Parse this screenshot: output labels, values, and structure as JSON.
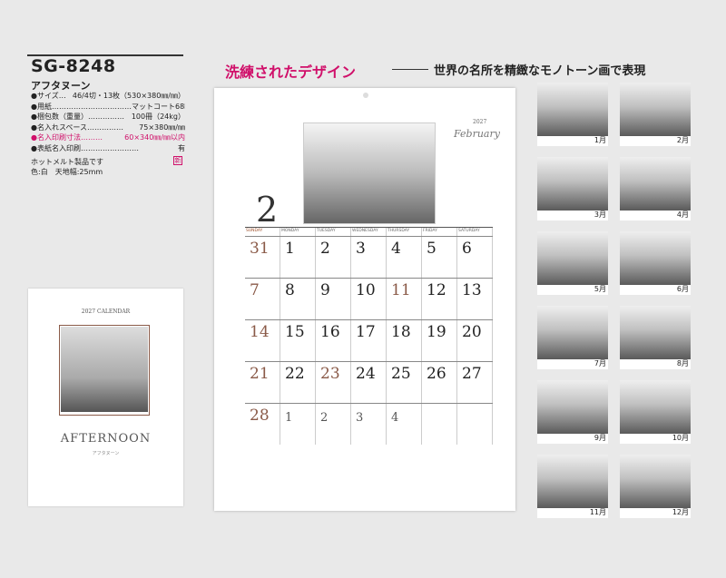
{
  "product": {
    "model": "SG-8248",
    "name": "アフタヌーン",
    "specs": [
      {
        "key": "●サイズ…",
        "value": "46/4切・13枚（530×380㎜/㎜）",
        "pink": false
      },
      {
        "key": "●用紙……………………………",
        "value": "マットコート68kg",
        "pink": false
      },
      {
        "key": "●梱包数（重量）……………",
        "value": "100冊（24kg）",
        "pink": false
      },
      {
        "key": "●名入れスペース……………",
        "value": "75×380㎜/㎜",
        "pink": false
      },
      {
        "key": "●名入印刷寸法………",
        "value": "60×340㎜/㎜以内",
        "pink": true
      },
      {
        "key": "●表紙名入印刷……………………",
        "value": "有",
        "pink": false
      }
    ],
    "hotmelt": "ホットメルト製品です",
    "color_size": "色:白　天地幅:25mm",
    "new_badge": "新"
  },
  "cover": {
    "calendar_label": "2027 CALENDAR",
    "title": "AFTERNOON",
    "subtitle": "アフタヌーン"
  },
  "headline": {
    "main": "洗練されたデザイン",
    "sub": "世界の名所を精緻なモノトーン画で表現"
  },
  "calendar": {
    "month_number": "2",
    "year": "2027",
    "month_name": "February",
    "weekdays": [
      "SUNDAY",
      "MONDAY",
      "TUESDAY",
      "WEDNESDAY",
      "THURSDAY",
      "FRIDAY",
      "SATURDAY"
    ],
    "weeks": [
      [
        "31",
        "1",
        "2",
        "3",
        "4",
        "5",
        "6"
      ],
      [
        "7",
        "8",
        "9",
        "10",
        "11",
        "12",
        "13"
      ],
      [
        "14",
        "15",
        "16",
        "17",
        "18",
        "19",
        "20"
      ],
      [
        "21",
        "22",
        "23",
        "24",
        "25",
        "26",
        "27"
      ],
      [
        "28",
        "1",
        "2",
        "3",
        "4",
        "",
        ""
      ]
    ]
  },
  "thumbnails": [
    "1月",
    "2月",
    "3月",
    "4月",
    "5月",
    "6月",
    "7月",
    "8月",
    "9月",
    "10月",
    "11月",
    "12月"
  ]
}
